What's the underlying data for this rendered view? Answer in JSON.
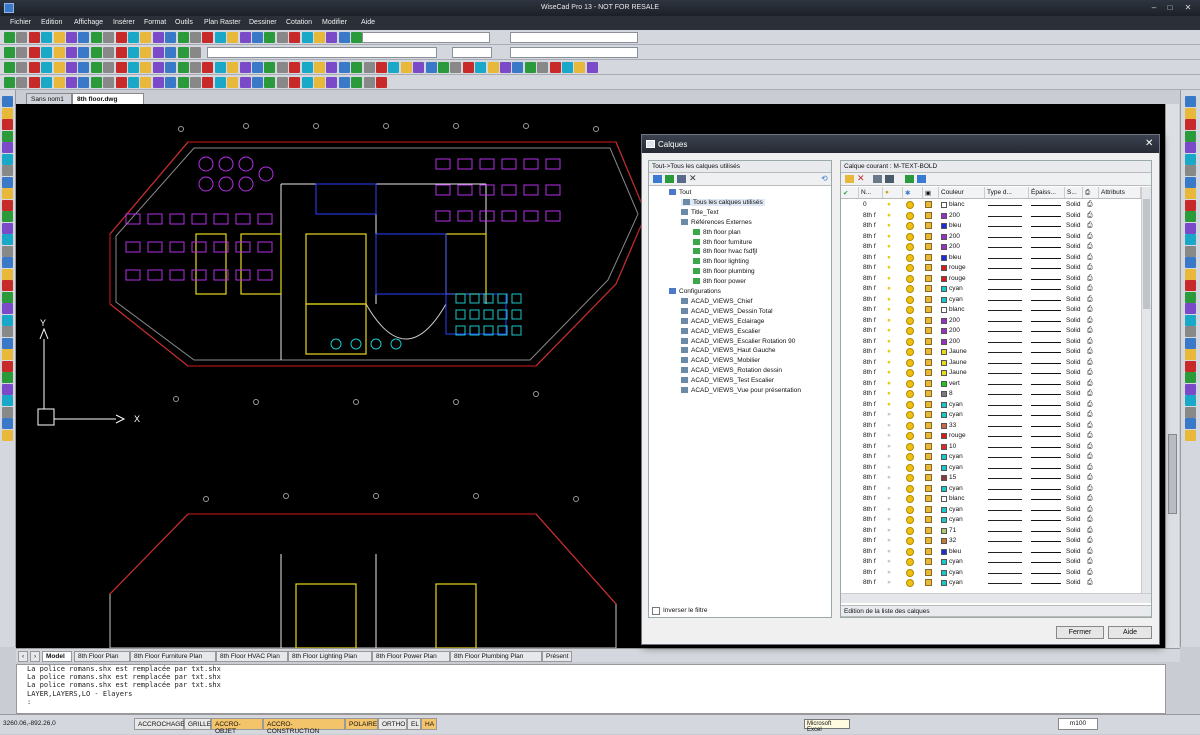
{
  "window": {
    "title": "WiseCad Pro 13 - NOT FOR RESALE",
    "controls": [
      "–",
      "□",
      "✕"
    ]
  },
  "menu": [
    "Fichier",
    "Edition",
    "Affichage",
    "Insérer",
    "Format",
    "Outils",
    "Plan Raster",
    "Dessiner",
    "Cotation",
    "Modifier",
    "Aide"
  ],
  "doc_tabs": [
    "Sans nom1",
    "8th floor.dwg"
  ],
  "canvas": {
    "axis_y": "Y",
    "axis_x": "X"
  },
  "layout_tabs": [
    "Model",
    "8th Floor Plan",
    "8th Floor Furniture Plan",
    "8th Floor HVAC Plan",
    "8th Floor Lighting Plan",
    "8th Floor Power Plan",
    "8th Floor Plumbing Plan",
    "Présent"
  ],
  "command_lines": [
    "La police romans.shx est remplacée par txt.shx",
    "La police romans.shx est remplacée par txt.shx",
    "La police romans.shx est remplacée par txt.shx",
    "LAYER,LAYERS,LO - Elayers",
    ":"
  ],
  "status": {
    "coords": "3260.06,-892.26,0",
    "buttons": [
      "ACCROCHAGE",
      "GRILLE",
      "ACCRO-OBJET",
      "ACCRO-CONSTRUCTION",
      "POLAIRE",
      "ORTHO",
      "EL",
      "HA"
    ],
    "taskbar": "Microsoft Excel",
    "scale": "m100"
  },
  "dialog": {
    "title": "Calques",
    "filter_header": "Tout->Tous les calques utilisés",
    "tree": [
      "Tout",
      "Tous les calques utilisés",
      "Title_Text",
      "Références Externes",
      "8th floor plan",
      "8th floor furniture",
      "8th floor hvac fsdfjl",
      "8th floor lighting",
      "8th floor plumbing",
      "8th floor power",
      "Configurations",
      "ACAD_VIEWS_Chief",
      "ACAD_VIEWS_Dessin Total",
      "ACAD_VIEWS_Eclairage",
      "ACAD_VIEWS_Escalier",
      "ACAD_VIEWS_Escalier Rotation 90",
      "ACAD_VIEWS_Haut Gauche",
      "ACAD_VIEWS_Mobilier",
      "ACAD_VIEWS_Rotation dessin",
      "ACAD_VIEWS_Test Escalier",
      "ACAD_VIEWS_Vue pour présentation"
    ],
    "invert_filter": "Inverser le filtre",
    "current_layer": "Calque courant : M-TEXT-BOLD",
    "columns": [
      "N...",
      "Couleur",
      "Type d...",
      "Épaiss...",
      "S...",
      "Attributs"
    ],
    "rows": [
      {
        "name": "0",
        "color": "blanc",
        "hex": "#ffffff"
      },
      {
        "name": "8th f",
        "color": "200",
        "hex": "#9a2fc8"
      },
      {
        "name": "8th f",
        "color": "bleu",
        "hex": "#1a2fd8"
      },
      {
        "name": "8th f",
        "color": "200",
        "hex": "#9a2fc8"
      },
      {
        "name": "8th f",
        "color": "200",
        "hex": "#9a2fc8"
      },
      {
        "name": "8th f",
        "color": "bleu",
        "hex": "#1a2fd8"
      },
      {
        "name": "8th f",
        "color": "rouge",
        "hex": "#d81a1a"
      },
      {
        "name": "8th f",
        "color": "rouge",
        "hex": "#d81a1a"
      },
      {
        "name": "8th f",
        "color": "cyan",
        "hex": "#19c8c8"
      },
      {
        "name": "8th f",
        "color": "cyan",
        "hex": "#19c8c8"
      },
      {
        "name": "8th f",
        "color": "blanc",
        "hex": "#ffffff"
      },
      {
        "name": "8th f",
        "color": "200",
        "hex": "#9a2fc8"
      },
      {
        "name": "8th f",
        "color": "200",
        "hex": "#9a2fc8"
      },
      {
        "name": "8th f",
        "color": "200",
        "hex": "#9a2fc8"
      },
      {
        "name": "8th f",
        "color": "Jaune",
        "hex": "#e8d81a"
      },
      {
        "name": "8th f",
        "color": "Jaune",
        "hex": "#e8d81a"
      },
      {
        "name": "8th f",
        "color": "Jaune",
        "hex": "#e8d81a"
      },
      {
        "name": "8th f",
        "color": "vert",
        "hex": "#1ac81a"
      },
      {
        "name": "8th f",
        "color": "8",
        "hex": "#7a7a7a"
      },
      {
        "name": "8th f",
        "color": "cyan",
        "hex": "#19c8c8"
      },
      {
        "name": "8th f",
        "color": "cyan",
        "hex": "#19c8c8"
      },
      {
        "name": "8th f",
        "color": "33",
        "hex": "#c86a4a"
      },
      {
        "name": "8th f",
        "color": "rouge",
        "hex": "#d81a1a"
      },
      {
        "name": "8th f",
        "color": "10",
        "hex": "#e02a2a"
      },
      {
        "name": "8th f",
        "color": "cyan",
        "hex": "#19c8c8"
      },
      {
        "name": "8th f",
        "color": "cyan",
        "hex": "#19c8c8"
      },
      {
        "name": "8th f",
        "color": "15",
        "hex": "#8a3a3a"
      },
      {
        "name": "8th f",
        "color": "cyan",
        "hex": "#19c8c8"
      },
      {
        "name": "8th f",
        "color": "blanc",
        "hex": "#ffffff"
      },
      {
        "name": "8th f",
        "color": "cyan",
        "hex": "#19c8c8"
      },
      {
        "name": "8th f",
        "color": "cyan",
        "hex": "#19c8c8"
      },
      {
        "name": "8th f",
        "color": "71",
        "hex": "#a8c870"
      },
      {
        "name": "8th f",
        "color": "32",
        "hex": "#c8782a"
      },
      {
        "name": "8th f",
        "color": "bleu",
        "hex": "#1a2fd8"
      },
      {
        "name": "8th f",
        "color": "cyan",
        "hex": "#19c8c8"
      },
      {
        "name": "8th f",
        "color": "cyan",
        "hex": "#19c8c8"
      },
      {
        "name": "8th f",
        "color": "cyan",
        "hex": "#19c8c8"
      }
    ],
    "linetype": "Solid",
    "footer_label": "Edition de la liste des calques",
    "close_button": "Fermer",
    "help_button": "Aide"
  }
}
